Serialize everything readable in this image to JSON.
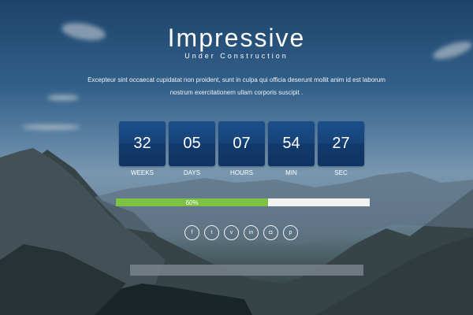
{
  "header": {
    "title": "Impressive",
    "subtitle": "Under Construction",
    "description": "Excepteur sint occaecat cupidatat non proident, sunt in culpa qui officia deserunt mollit anim id est laborum nostrum exercitationem ullam corporis suscipit ."
  },
  "countdown": [
    {
      "value": "32",
      "label": "WEEKS"
    },
    {
      "value": "05",
      "label": "DAYS"
    },
    {
      "value": "07",
      "label": "HOURS"
    },
    {
      "value": "54",
      "label": "MIN"
    },
    {
      "value": "27",
      "label": "SEC"
    }
  ],
  "progress": {
    "percent": 60,
    "text": "60%",
    "fill_color": "#7dc242",
    "track_color": "#f2f2f2"
  },
  "social": [
    {
      "name": "facebook-icon",
      "glyph": "f"
    },
    {
      "name": "twitter-icon",
      "glyph": "t"
    },
    {
      "name": "vimeo-icon",
      "glyph": "v"
    },
    {
      "name": "linkedin-icon",
      "glyph": "in"
    },
    {
      "name": "instagram-icon",
      "glyph": "◘"
    },
    {
      "name": "pinterest-icon",
      "glyph": "p"
    }
  ],
  "colors": {
    "countdown_box": "#164277",
    "accent": "#7dc242"
  }
}
